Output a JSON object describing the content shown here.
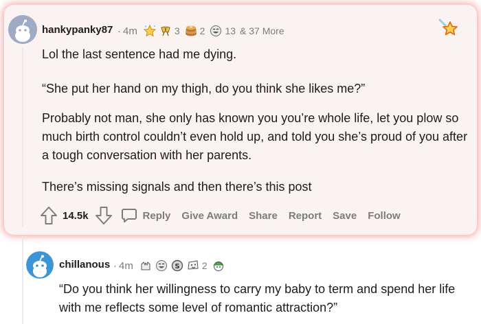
{
  "comment1": {
    "username": "hankypanky87",
    "separator": "·",
    "age": "4m",
    "awards": [
      {
        "icon": "sparkle-star-award-icon",
        "count": ""
      },
      {
        "icon": "cheers-award-icon",
        "count": "3"
      },
      {
        "icon": "pancake-stack-award-icon",
        "count": "2"
      },
      {
        "icon": "laughing-face-award-icon",
        "count": "13"
      }
    ],
    "more_awards": "& 37 More",
    "paragraphs": [
      "Lol the last sentence had me dying.",
      "“She put her hand on my thigh, do you think she likes me?”",
      "Probably not man, she only has known you you’re whole life, let you plow so much birth control couldn’t even hold up, and told you she’s proud of you after a tough conversation with her parents.",
      "There’s missing signals and then there’s this post"
    ],
    "score": "14.5k",
    "actions": {
      "reply": "Reply",
      "give_award": "Give Award",
      "share": "Share",
      "report": "Report",
      "save": "Save",
      "follow": "Follow"
    },
    "highlight_color": "#e8494e"
  },
  "comment2": {
    "username": "chillanous",
    "separator": "·",
    "age": "4m",
    "awards": [
      {
        "icon": "hands-award-icon",
        "count": ""
      },
      {
        "icon": "laughing-face-award-icon",
        "count": ""
      },
      {
        "icon": "silver-award-icon",
        "count": ""
      },
      {
        "icon": "face-award-icon",
        "count": "2"
      },
      {
        "icon": "green-cap-face-award-icon",
        "count": ""
      }
    ],
    "paragraphs": [
      "“Do you think her willingness to carry my baby to term and spend her life with me reflects some level of romantic attraction?”"
    ]
  }
}
